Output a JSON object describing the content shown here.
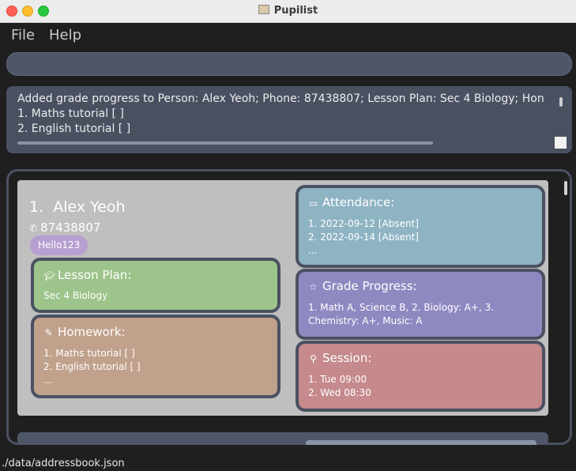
{
  "window": {
    "title": "Pupilist"
  },
  "menu": {
    "file": "File",
    "help": "Help"
  },
  "command_box": {
    "value": ""
  },
  "result": {
    "lines": [
      "Added grade progress to Person: Alex Yeoh; Phone: 87438807; Lesson Plan: Sec 4 Biology; Hon",
      "1. Maths tutorial [ ]",
      "2. English tutorial [ ]"
    ]
  },
  "person": {
    "index": "1.",
    "name": "Alex Yeoh",
    "phone": "87438807",
    "tag": "Hello123",
    "lesson_plan": {
      "title": "Lesson Plan:",
      "value": "Sec 4 Biology"
    },
    "homework": {
      "title": "Homework:",
      "items": [
        "1. Maths tutorial [ ]",
        "2. English tutorial [ ]",
        "..."
      ]
    },
    "attendance": {
      "title": "Attendance:",
      "items": [
        "1. 2022-09-12 [Absent]",
        "2. 2022-09-14 [Absent]",
        "..."
      ]
    },
    "grade_progress": {
      "title": "Grade Progress:",
      "items": [
        "1. Math A, Science B, 2. Biology: A+, 3.",
        "Chemistry: A+, Music: A"
      ]
    },
    "session": {
      "title": "Session:",
      "items": [
        "1. Tue 09:00",
        "2. Wed 08:30"
      ]
    }
  },
  "status_bar": {
    "path": "./data/addressbook.json"
  },
  "icons": {
    "phone": "phone-icon",
    "lesson_plan": "graduation-cap-icon",
    "homework": "pencil-icon",
    "attendance": "calendar-icon",
    "grade_progress": "star-icon",
    "session": "person-icon"
  },
  "colors": {
    "lesson_plan": "#9dc48b",
    "homework": "#c0a18b",
    "attendance": "#8eb3c3",
    "grade_progress": "#8f89c1",
    "session": "#c68a8c",
    "tag": "#b79fd1"
  }
}
